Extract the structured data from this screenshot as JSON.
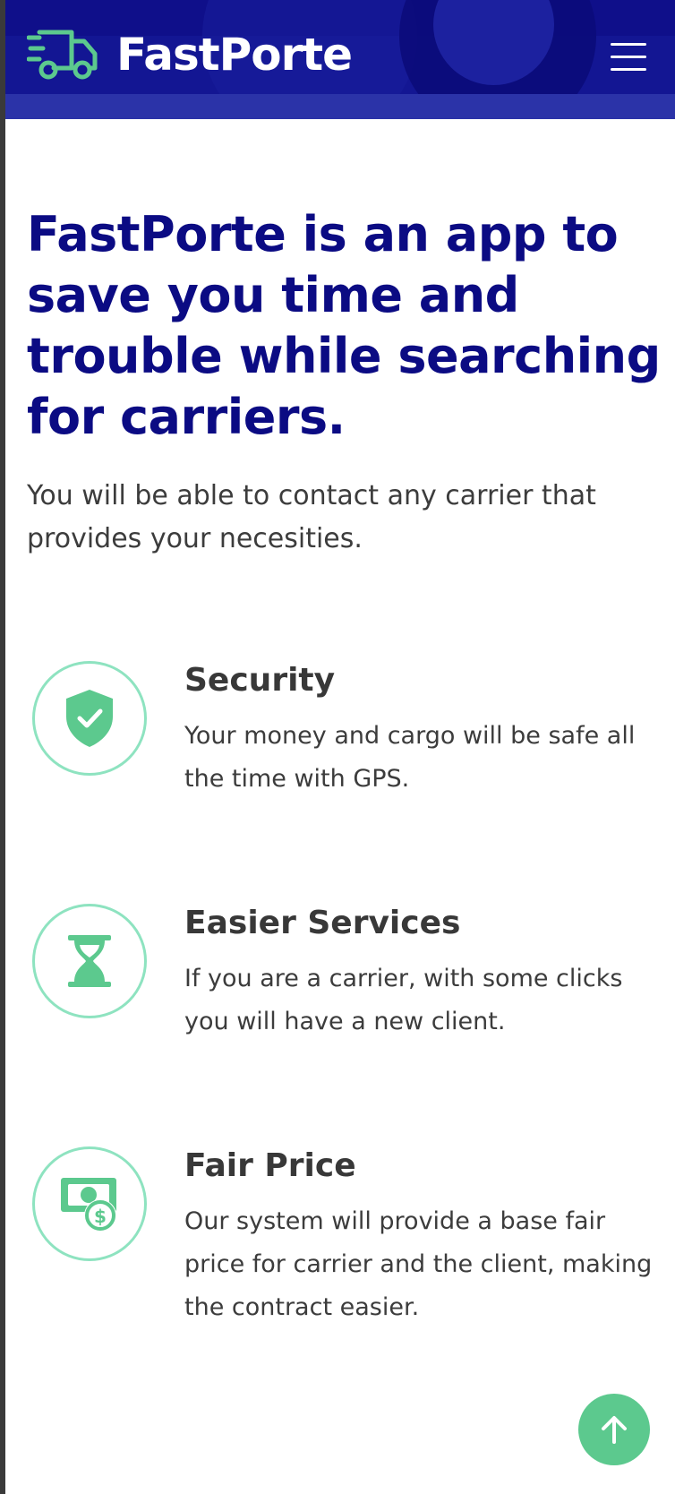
{
  "header": {
    "brand": "FastPorte",
    "logo_icon": "truck-fast-icon",
    "menu_icon": "hamburger-menu-icon",
    "background_color": "#0f0f8a",
    "accent_color": "#5cc98e"
  },
  "hero": {
    "title": "FastPorte is an app to save you time and trouble while searching for carriers.",
    "subtitle": "You will be able to contact any carrier that provides your necesities."
  },
  "features": [
    {
      "icon": "shield-check-icon",
      "title": "Security",
      "description": "Your money and cargo will be safe all the time with GPS."
    },
    {
      "icon": "hourglass-icon",
      "title": "Easier Services",
      "description": "If you are a carrier, with some clicks you will have a new client."
    },
    {
      "icon": "money-dollar-icon",
      "title": "Fair Price",
      "description": "Our system will provide a base fair price for carrier and the client, making the contract easier."
    }
  ],
  "scroll_top": {
    "icon": "arrow-up-icon"
  },
  "colors": {
    "title_blue": "#0b0b83",
    "icon_green": "#5cc98e",
    "circle_border": "#8ee3c0",
    "text_gray": "#3c3c3c"
  }
}
